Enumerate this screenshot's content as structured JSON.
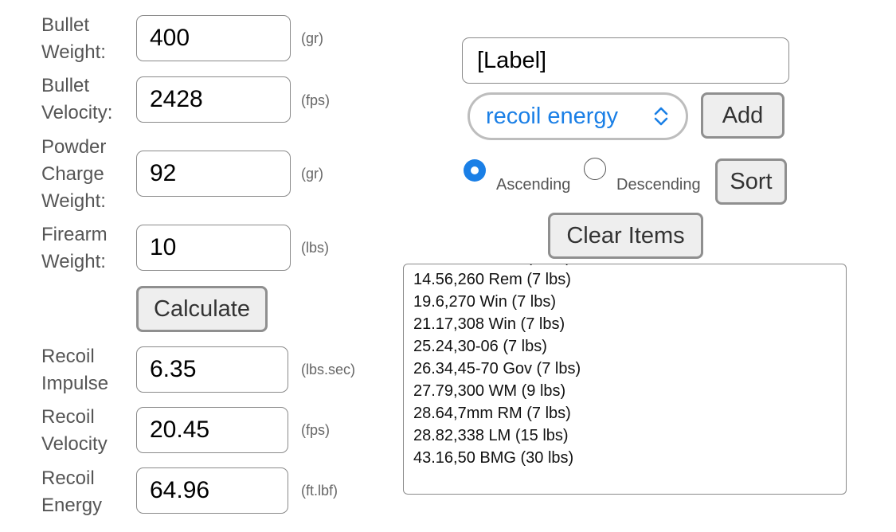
{
  "calculator": {
    "bullet_weight": {
      "label_line1": "Bullet",
      "label_line2": "Weight:",
      "value": "400",
      "unit": "(gr)"
    },
    "bullet_velocity": {
      "label_line1": "Bullet",
      "label_line2": "Velocity:",
      "value": "2428",
      "unit": "(fps)"
    },
    "powder_charge": {
      "label_line1": "Powder",
      "label_line2": "Charge",
      "label_line3": "Weight:",
      "value": "92",
      "unit": "(gr)"
    },
    "firearm_weight": {
      "label_line1": "Firearm",
      "label_line2": "Weight:",
      "value": "10",
      "unit": "(lbs)"
    },
    "calculate_label": "Calculate"
  },
  "results": {
    "recoil_impulse": {
      "label_line1": "Recoil",
      "label_line2": "Impulse",
      "value": "6.35",
      "unit": "(lbs.sec)"
    },
    "recoil_velocity": {
      "label_line1": "Recoil",
      "label_line2": "Velocity",
      "value": "20.45",
      "unit": "(fps)"
    },
    "recoil_energy": {
      "label_line1": "Recoil",
      "label_line2": "Energy",
      "value": "64.96",
      "unit": "(ft.lbf)"
    }
  },
  "list_panel": {
    "label_input_value": "[Label]",
    "metric_select_value": "recoil energy",
    "add_label": "Add",
    "ascending_label": "Ascending",
    "descending_label": "Descending",
    "ascending_checked": true,
    "sort_label": "Sort",
    "clear_label": "Clear Items",
    "items": [
      "14.56,260 Rem (7 lbs)",
      "19.6,270 Win (7 lbs)",
      "21.17,308 Win (7 lbs)",
      "25.24,30-06 (7 lbs)",
      "26.34,45-70 Gov (7 lbs)",
      "27.79,300 WM (9 lbs)",
      "28.64,7mm RM (7 lbs)",
      "28.82,338 LM (15 lbs)",
      "43.16,50 BMG (30 lbs)"
    ]
  },
  "colors": {
    "accent": "#1a7fe6",
    "border": "#8a8a8a",
    "button_bg": "#eeeeee"
  }
}
